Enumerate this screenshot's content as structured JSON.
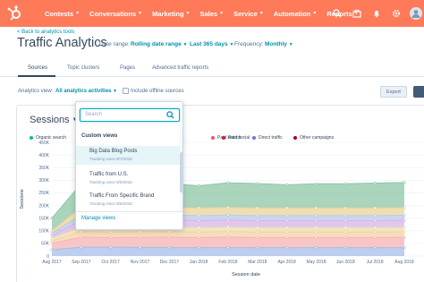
{
  "nav": {
    "items": [
      "Contests",
      "Conversations",
      "Marketing",
      "Sales",
      "Service",
      "Automation",
      "Reports"
    ],
    "icons": [
      "search-icon",
      "marketplace-icon",
      "notifications-icon",
      "settings-icon",
      "avatar"
    ],
    "color": "#ff7a59"
  },
  "header": {
    "back_link": "< Back to analytics tools",
    "title": "Traffic Analytics",
    "date_range_label": "Date range:",
    "date_range_value": "Rolling date range",
    "period_value": "Last 365 days",
    "frequency_label": "Frequency:",
    "frequency_value": "Monthly"
  },
  "tabs": [
    "Sources",
    "Topic clusters",
    "Pages",
    "Advanced traffic reports"
  ],
  "toolbar": {
    "analytics_view_label": "Analytics view:",
    "analytics_view_value": "All analytics activities",
    "include_offline_label": "Include offline sources",
    "export_label": "Export"
  },
  "dropdown": {
    "search_placeholder": "Search",
    "group_label": "Custom views",
    "items": [
      {
        "title": "Big Data Blog Posts",
        "subtitle": "Tracking since 8/7/2018"
      },
      {
        "title": "Traffic from U.S.",
        "subtitle": "Tracking since 8/9/2018"
      },
      {
        "title": "Traffic From Specific Brand",
        "subtitle": "Tracking since 8/9/2018"
      }
    ],
    "manage_label": "Manage views"
  },
  "chart_data": {
    "type": "area",
    "title": "Sessions",
    "xlabel": "Session date",
    "ylabel": "Sessions",
    "ylim": [
      0,
      450000
    ],
    "yticks": [
      "0",
      "50K",
      "100K",
      "150K",
      "200K",
      "250K",
      "300K",
      "350K",
      "400K",
      "450K"
    ],
    "categories": [
      "Aug 2017",
      "Sep 2017",
      "Oct 2017",
      "Nov 2017",
      "Dec 2017",
      "Jan 2018",
      "Feb 2018",
      "Mar 2018",
      "Apr 2018",
      "May 2018",
      "Jun 2018",
      "Jul 2018",
      "Aug 2018"
    ],
    "legend_position": "top",
    "series": [
      {
        "name": "Organic search",
        "color": "#8ec7a6",
        "values": [
          50000,
          95000,
          95000,
          96000,
          95000,
          88000,
          98000,
          97000,
          92000,
          96000,
          96000,
          99000,
          100000
        ]
      },
      {
        "name": "",
        "color": "#e9d39a",
        "values": [
          10000,
          30000,
          30000,
          30000,
          30000,
          30000,
          30000,
          30000,
          30000,
          30000,
          30000,
          30000,
          30000
        ]
      },
      {
        "name": "",
        "color": "#b9c9e6",
        "values": [
          10000,
          20000,
          20000,
          20000,
          20000,
          20000,
          20000,
          20000,
          20000,
          20000,
          20000,
          20000,
          20000
        ]
      },
      {
        "name": "Direct traffic",
        "color": "#d9b3e8",
        "values": [
          10000,
          28000,
          28000,
          28000,
          28000,
          28000,
          28000,
          28000,
          28000,
          28000,
          28000,
          28000,
          28000
        ]
      },
      {
        "name": "Paid social",
        "color": "#e9e0a8",
        "values": [
          10000,
          17000,
          17000,
          17000,
          17000,
          17000,
          17000,
          17000,
          17000,
          17000,
          17000,
          17000,
          17000
        ]
      },
      {
        "name": "Other campaigns",
        "color": "#f6d0a8",
        "values": [
          10000,
          22000,
          22000,
          22000,
          22000,
          22000,
          22000,
          22000,
          22000,
          22000,
          22000,
          22000,
          22000
        ]
      },
      {
        "name": "Paid search",
        "color": "#f5b3b3",
        "values": [
          25000,
          40000,
          38000,
          40000,
          42000,
          40000,
          42000,
          40000,
          40000,
          40000,
          40000,
          40000,
          41000
        ]
      },
      {
        "name": "",
        "color": "#a7bde8",
        "values": [
          25000,
          35000,
          35000,
          34000,
          33000,
          33000,
          33000,
          33000,
          33000,
          33000,
          33000,
          33000,
          33000
        ]
      }
    ],
    "visible_legend": [
      "Organic search",
      "Paid search",
      "Paid social",
      "Direct traffic",
      "Other campaigns"
    ]
  }
}
